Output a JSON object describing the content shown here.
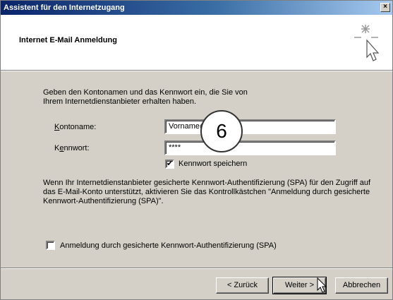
{
  "window": {
    "title": "Assistent für den Internetzugang",
    "close_glyph": "×"
  },
  "header": {
    "title": "Internet E-Mail Anmeldung",
    "icon": "wizard-sparkle-cursor-icon"
  },
  "intro_text": "Geben den Kontonamen und das Kennwort ein, die Sie von Ihrem Internetdienstanbieter erhalten haben.",
  "form": {
    "account_label_prefix": "K",
    "account_label_rest": "ontoname:",
    "account_value": "Vorname@",
    "account_value_tail": "@",
    "password_label_prefix": "K",
    "password_label_mid": "e",
    "password_label_rest": "nnwort:",
    "password_value": "****",
    "remember_label": "Kennwort speichern",
    "remember_checked": true
  },
  "spa_description": "Wenn Ihr Internetdienstanbieter gesicherte Kennwort-Authentifizierung (SPA) für den Zugriff auf das E-Mail-Konto unterstützt, aktivieren Sie das Kontrollkästchen \"Anmeldung durch gesicherte Kennwort-Authentifizierung (SPA)\".",
  "spa_checkbox": {
    "label": "Anmeldung durch gesicherte Kennwort-Authentifizierung (SPA)",
    "checked": false
  },
  "buttons": {
    "back": "< Zurück",
    "next": "Weiter >",
    "cancel": "Abbrechen"
  },
  "step_badge": "6"
}
